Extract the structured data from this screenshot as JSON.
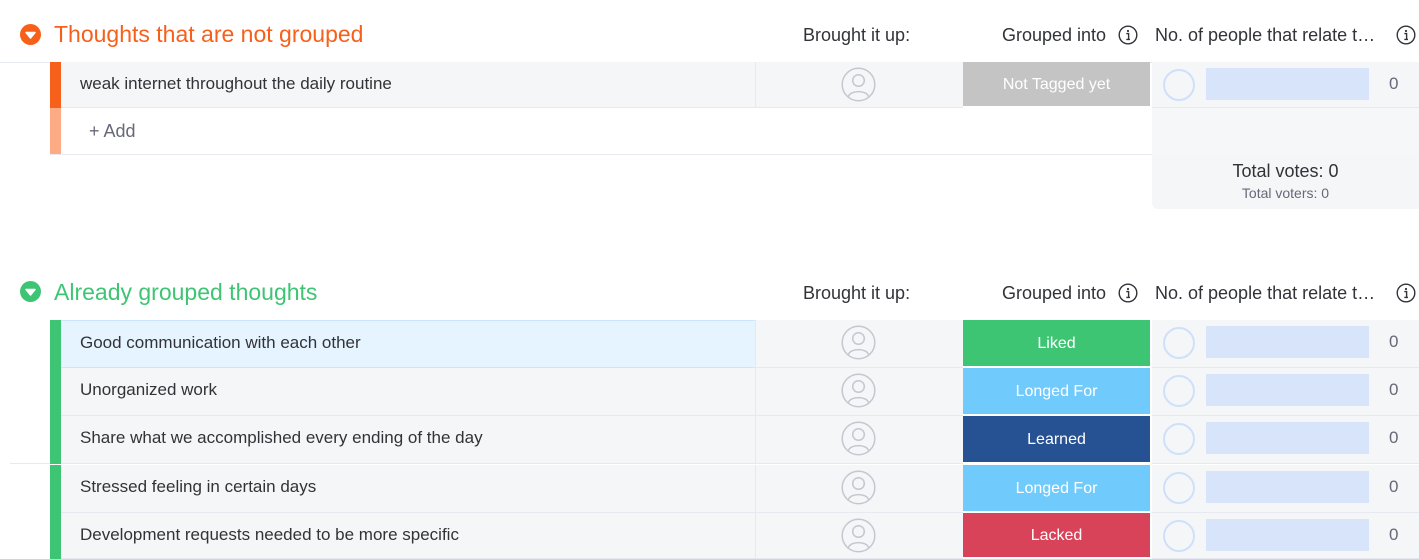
{
  "colors": {
    "ungrouped_accent": "#f7601b",
    "ungrouped_add_bar": "#fdab84",
    "grouped_accent": "#3ec574",
    "status_not_tagged": "#c4c4c4",
    "status_liked": "#3ec574",
    "status_longed_for": "#70cbfc",
    "status_learned": "#265193",
    "status_lacked": "#d9435a"
  },
  "columns": {
    "brought_it_up": "Brought it up:",
    "grouped_into": "Grouped into",
    "people_relate": "No. of people that relate t…"
  },
  "icons": {
    "toggle": "chevron-down-circle-icon",
    "info": "info-icon",
    "avatar": "person-avatar-icon",
    "vote": "vote-circle-icon"
  },
  "ungrouped": {
    "title": "Thoughts that are not grouped",
    "items": [
      {
        "text": "weak internet throughout the daily routine",
        "status": "Not Tagged yet",
        "votes": "0"
      }
    ],
    "add_label": "+ Add",
    "total_votes": "Total votes: 0",
    "total_voters": "Total voters: 0"
  },
  "grouped": {
    "title": "Already grouped thoughts",
    "items": [
      {
        "text": "Good communication with each other",
        "status": "Liked",
        "votes": "0"
      },
      {
        "text": "Unorganized work",
        "status": "Longed For",
        "votes": "0"
      },
      {
        "text": "Share what we accomplished every ending of the day",
        "status": "Learned",
        "votes": "0"
      },
      {
        "text": "Stressed feeling in certain days",
        "status": "Longed For",
        "votes": "0"
      },
      {
        "text": "Development requests needed to be more specific",
        "status": "Lacked",
        "votes": "0"
      }
    ]
  }
}
